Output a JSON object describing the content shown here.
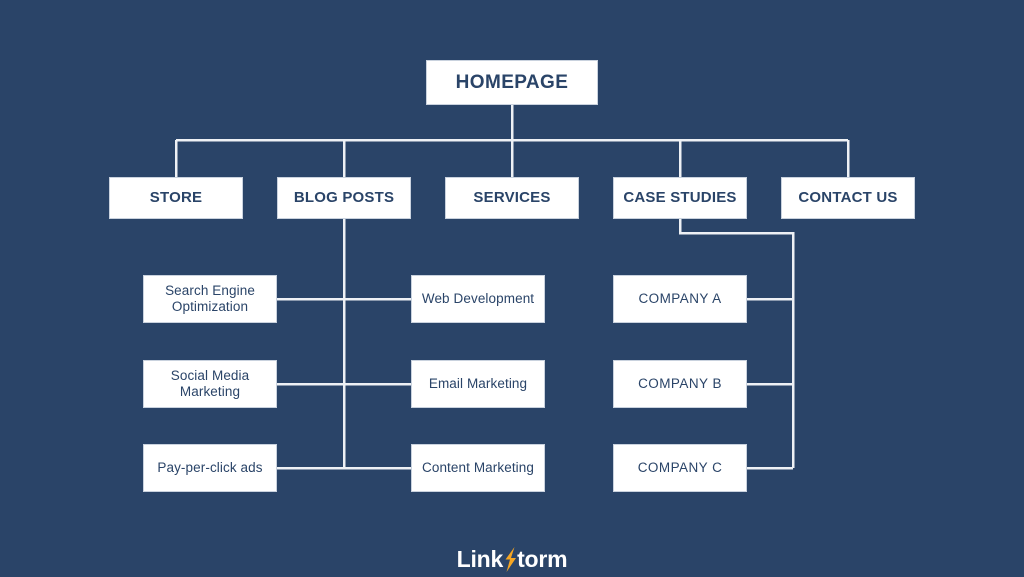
{
  "theme": {
    "background": "#2a4468",
    "box_fill": "#ffffff",
    "box_border": "#c9d2de",
    "text_navy": "#2a4468",
    "line": "#eef1f5",
    "logo_text": "#ffffff",
    "logo_bolt": "#f5a623"
  },
  "diagram": {
    "type": "sitemap-tree",
    "root": {
      "label": "HOMEPAGE"
    },
    "level2": [
      {
        "label": "STORE"
      },
      {
        "label": "BLOG POSTS"
      },
      {
        "label": "SERVICES"
      },
      {
        "label": "CASE STUDIES"
      },
      {
        "label": "CONTACT US"
      }
    ],
    "left_children": [
      {
        "label": "Search Engine Optimization"
      },
      {
        "label": "Social Media Marketing"
      },
      {
        "label": "Pay-per-click ads"
      }
    ],
    "middle_children": [
      {
        "label": "Web Development"
      },
      {
        "label": "Email Marketing"
      },
      {
        "label": "Content Marketing"
      }
    ],
    "right_children": [
      {
        "label": "COMPANY A"
      },
      {
        "label": "COMPANY B"
      },
      {
        "label": "COMPANY C"
      }
    ]
  },
  "footer": {
    "logo_part1": "Link",
    "logo_part2": "torm",
    "logo_icon": "lightning-bolt-icon"
  }
}
